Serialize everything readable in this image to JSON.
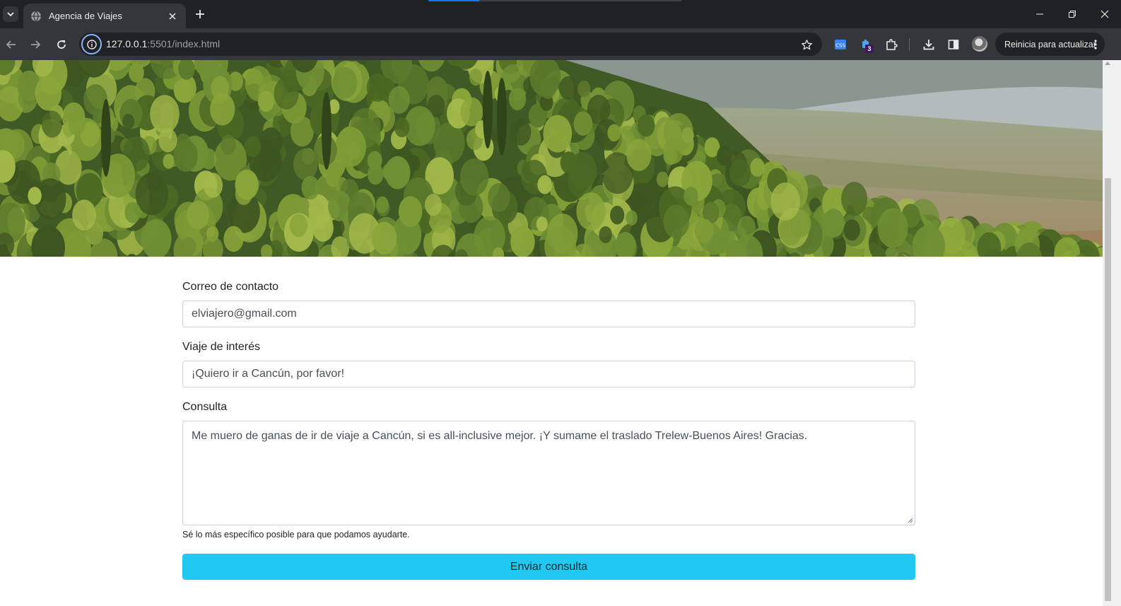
{
  "browser": {
    "tab_title": "Agencia de Viajes",
    "url_host": "127.0.0.1",
    "url_path": ":5501/index.html",
    "extension_badge": "3",
    "update_label": "Reinicia para actualizar"
  },
  "form": {
    "email_label": "Correo de contacto",
    "email_value": "elviajero@gmail.com",
    "trip_label": "Viaje de interés",
    "trip_value": "¡Quiero ir a Cancún, por favor!",
    "query_label": "Consulta",
    "query_value": "Me muero de ganas de ir de viaje a Cancún, si es all-inclusive mejor. ¡Y sumame el traslado Trelew-Buenos Aires! Gracias.",
    "help_text": "Sé lo más específico posible para que podamos ayudarte.",
    "submit_label": "Enviar consulta"
  },
  "colors": {
    "submit_bg": "#21c9f2",
    "chrome_dark": "#202124",
    "chrome_toolbar": "#35363a"
  }
}
